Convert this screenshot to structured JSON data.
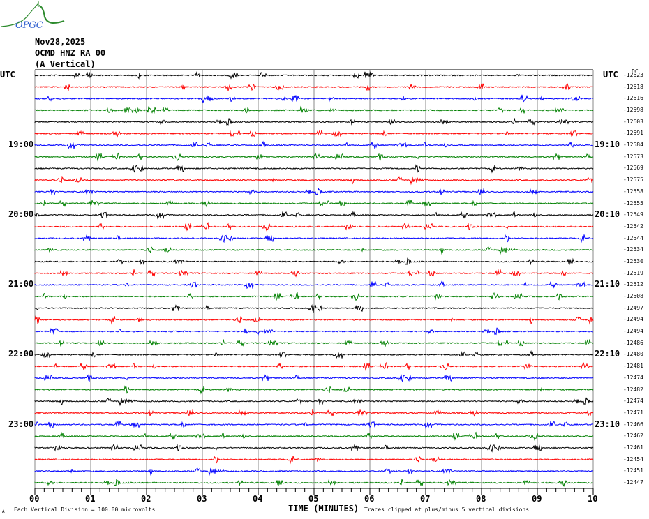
{
  "logo": {
    "text": "OPGC"
  },
  "header": {
    "date": "Nov28,2025",
    "station": "OCMD HNZ RA 00",
    "component": "(A Vertical)"
  },
  "left_utc_label": "UTC",
  "right_utc_label": "UTC",
  "dc_label": "DC",
  "chart_data": {
    "type": "line",
    "title": "OCMD HNZ RA 00 (A Vertical) Nov28,2025",
    "xlabel": "TIME (MINUTES)",
    "x_ticks": [
      "00",
      "01",
      "02",
      "03",
      "04",
      "05",
      "06",
      "07",
      "08",
      "09",
      "10"
    ],
    "xlim": [
      0,
      10
    ],
    "trace_colors": [
      "#000000",
      "#ff0000",
      "#0000ff",
      "#008000"
    ],
    "left_time_labels": [
      {
        "row": 6,
        "label": "19:00"
      },
      {
        "row": 12,
        "label": "20:00"
      },
      {
        "row": 18,
        "label": "21:00"
      },
      {
        "row": 24,
        "label": "22:00"
      },
      {
        "row": 30,
        "label": "23:00"
      }
    ],
    "right_time_labels": [
      {
        "row": 6,
        "label": "19:10"
      },
      {
        "row": 12,
        "label": "20:10"
      },
      {
        "row": 18,
        "label": "21:10"
      },
      {
        "row": 24,
        "label": "22:10"
      },
      {
        "row": 30,
        "label": "23:10"
      }
    ],
    "dc_offsets": [
      -12623,
      -12618,
      -12616,
      -12598,
      -12603,
      -12591,
      -12584,
      -12573,
      -12569,
      -12575,
      -12558,
      -12555,
      -12549,
      -12542,
      -12544,
      -12534,
      -12530,
      -12519,
      -12512,
      -12508,
      -12497,
      -12494,
      -12494,
      -12486,
      -12480,
      -12481,
      -12474,
      -12482,
      -12474,
      -12471,
      -12466,
      -12462,
      -12461,
      -12454,
      -12451,
      -12447
    ],
    "minutes_per_trace": 10
  },
  "footer": {
    "scale_note": "Each Vertical Division =  100.00 microvolts",
    "clip_note": "Traces clipped at plus/minus 5 vertical divisions",
    "corner_mark": "A"
  }
}
